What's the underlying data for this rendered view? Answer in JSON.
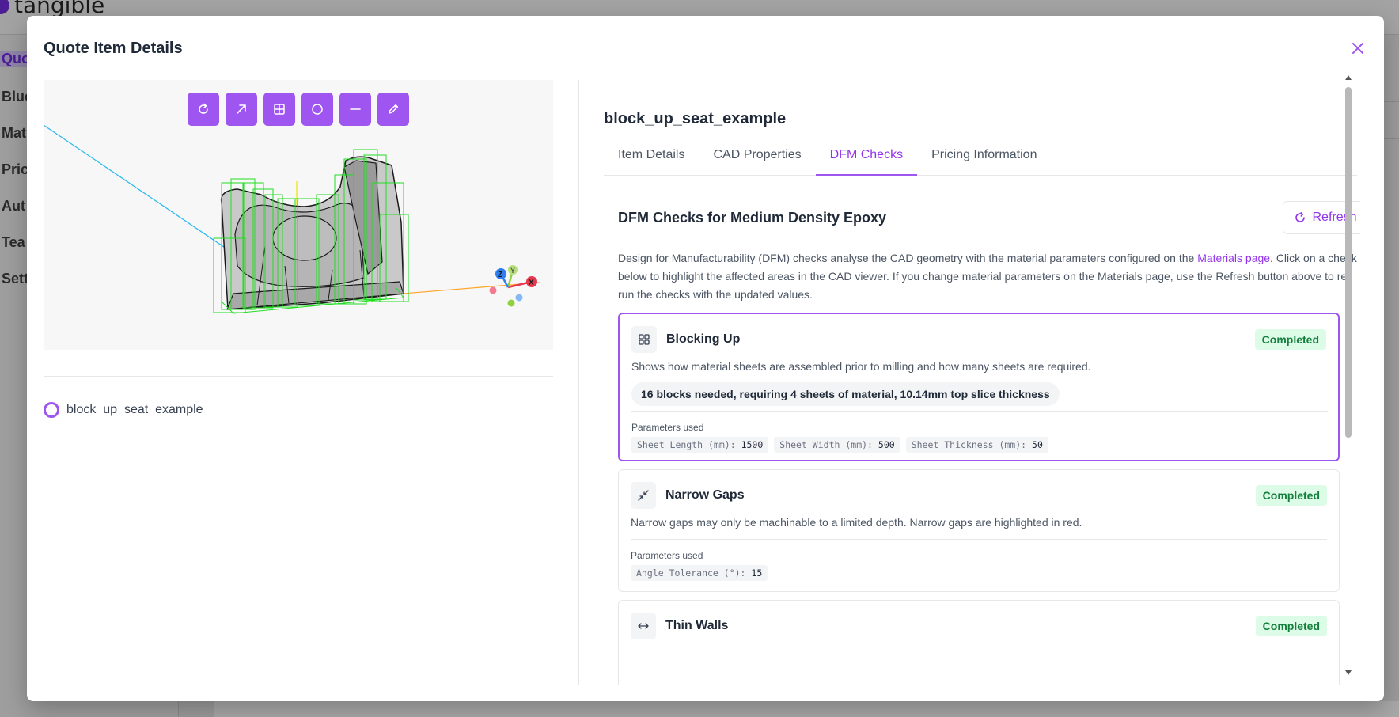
{
  "app": {
    "logo_text": "tangible"
  },
  "background_nav": [
    "Quo",
    "Blue",
    "Mat",
    "Pric",
    "Aut",
    "Tea",
    "Sett"
  ],
  "modal": {
    "title": "Quote Item Details"
  },
  "viewer": {
    "tools": [
      "rotate-icon",
      "arrow-icon",
      "grid-icon",
      "circle-icon",
      "line-icon",
      "pencil-icon"
    ],
    "axis_labels": {
      "x": "X",
      "y": "Y",
      "z": "Z"
    }
  },
  "file": {
    "name": "block_up_seat_example"
  },
  "item": {
    "title": "block_up_seat_example"
  },
  "tabs": [
    "Item Details",
    "CAD Properties",
    "DFM Checks",
    "Pricing Information"
  ],
  "active_tab": "DFM Checks",
  "dfm": {
    "title": "DFM Checks for Medium Density Epoxy",
    "refresh_label": "Refresh",
    "description_part1": "Design for Manufacturability (DFM) checks analyse the CAD geometry with the material parameters configured on the ",
    "description_link": "Materials page",
    "description_part2": ". Click on a check below to highlight the affected areas in the CAD viewer. If you change material parameters on the Materials page, use the Refresh button above to re-run the checks with the updated values.",
    "params_label": "Parameters used",
    "checks": [
      {
        "name": "Blocking Up",
        "status": "Completed",
        "description": "Shows how material sheets are assembled prior to milling and how many sheets are required.",
        "result": "16 blocks needed, requiring 4 sheets of material, 10.14mm top slice thickness",
        "params": [
          {
            "key": "Sheet Length (mm):",
            "value": "1500"
          },
          {
            "key": "Sheet Width (mm):",
            "value": "500"
          },
          {
            "key": "Sheet Thickness (mm):",
            "value": "50"
          }
        ]
      },
      {
        "name": "Narrow Gaps",
        "status": "Completed",
        "description": "Narrow gaps may only be machinable to a limited depth. Narrow gaps are highlighted in red.",
        "params": [
          {
            "key": "Angle Tolerance (°):",
            "value": "15"
          }
        ]
      },
      {
        "name": "Thin Walls",
        "status": "Completed"
      }
    ]
  },
  "colors": {
    "accent": "#9f55f0",
    "accent_text": "#9333ea",
    "badge_bg": "#dcfce7",
    "badge_text": "#15803d",
    "mesh_green": "#22dd22",
    "axis_x": "#e53950",
    "axis_y": "#8fd13f",
    "axis_z": "#2e7ef0"
  }
}
